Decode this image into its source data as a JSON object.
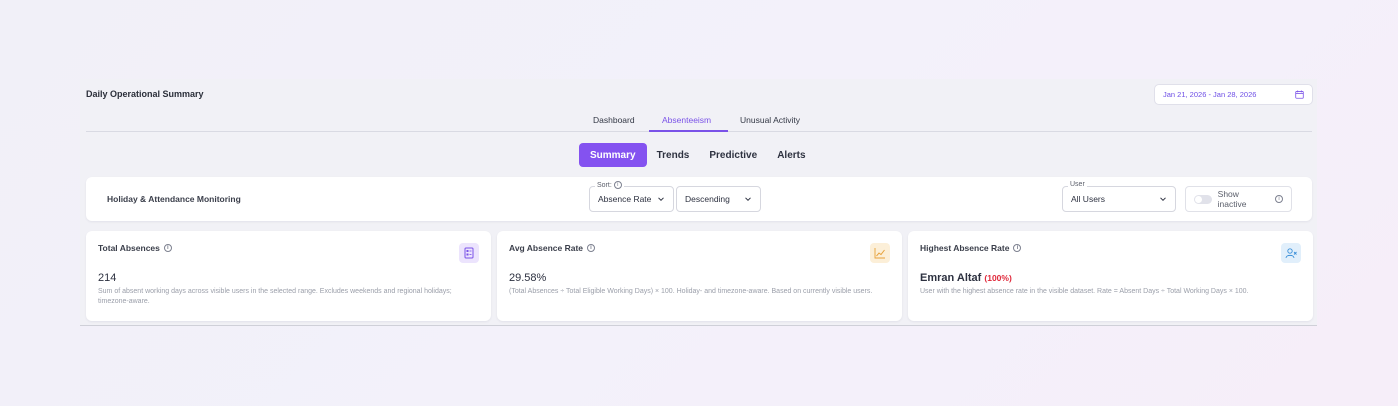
{
  "header": {
    "title": "Daily Operational Summary",
    "date_range": "Jan 21, 2026 - Jan 28, 2026"
  },
  "tabs": [
    {
      "label": "Dashboard",
      "active": false
    },
    {
      "label": "Absenteeism",
      "active": true
    },
    {
      "label": "Unusual Activity",
      "active": false
    }
  ],
  "subtabs": [
    {
      "label": "Summary",
      "active": true
    },
    {
      "label": "Trends",
      "active": false
    },
    {
      "label": "Predictive",
      "active": false
    },
    {
      "label": "Alerts",
      "active": false
    }
  ],
  "filters": {
    "title": "Holiday & Attendance Monitoring",
    "sort_label": "Sort:",
    "sort_field": "Absence Rate",
    "sort_order": "Descending",
    "user_label": "User",
    "user_value": "All Users",
    "show_inactive_label": "Show inactive",
    "show_inactive": false
  },
  "cards": [
    {
      "title": "Total Absences",
      "value": "214",
      "description": "Sum of absent working days across visible users in the selected range. Excludes weekends and regional holidays; timezone-aware.",
      "icon": "report-icon",
      "icon_color": "#7a52e8",
      "icon_bg": "#ece4fd"
    },
    {
      "title": "Avg Absence Rate",
      "value": "29.58%",
      "description": "(Total Absences ÷ Total Eligible Working Days) × 100. Holiday- and timezone-aware. Based on currently visible users.",
      "icon": "line-chart-icon",
      "icon_color": "#e7a13a",
      "icon_bg": "#fcefd8"
    },
    {
      "title": "Highest Absence Rate",
      "value_name": "Emran Altaf",
      "value_pct": "(100%)",
      "description": "User with the highest absence rate in the visible dataset. Rate = Absent Days ÷ Total Working Days × 100.",
      "icon": "user-x-icon",
      "icon_color": "#3a8fd9",
      "icon_bg": "#e1effb"
    }
  ]
}
